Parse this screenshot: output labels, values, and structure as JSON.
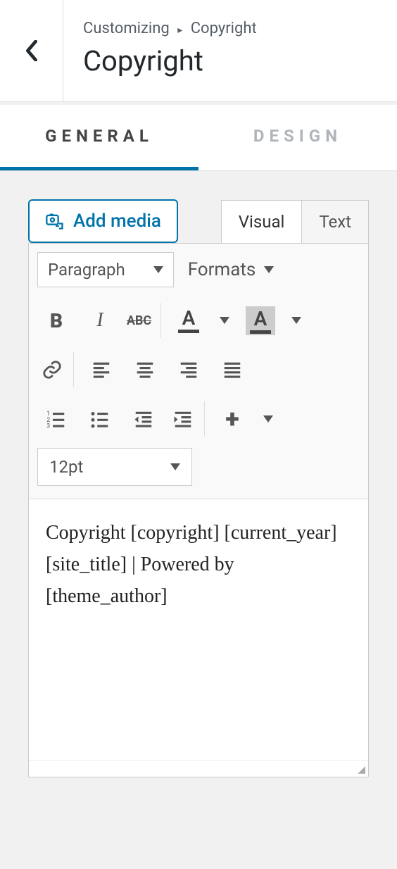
{
  "header": {
    "breadcrumb_root": "Customizing",
    "breadcrumb_sep": "▸",
    "breadcrumb_current": "Copyright",
    "title": "Copyright"
  },
  "tabs": {
    "general": "GENERAL",
    "design": "DESIGN"
  },
  "toolbar": {
    "add_media": "Add media",
    "mode_visual": "Visual",
    "mode_text": "Text",
    "paragraph": "Paragraph",
    "formats": "Formats",
    "fontsize": "12pt",
    "strike_label": "ABC",
    "textcolor_letter": "A",
    "bgcolor_letter": "A",
    "plus": "+"
  },
  "content": {
    "body": "Copyright [copyright] [current_year] [site_title] | Powered by [theme_author]"
  }
}
